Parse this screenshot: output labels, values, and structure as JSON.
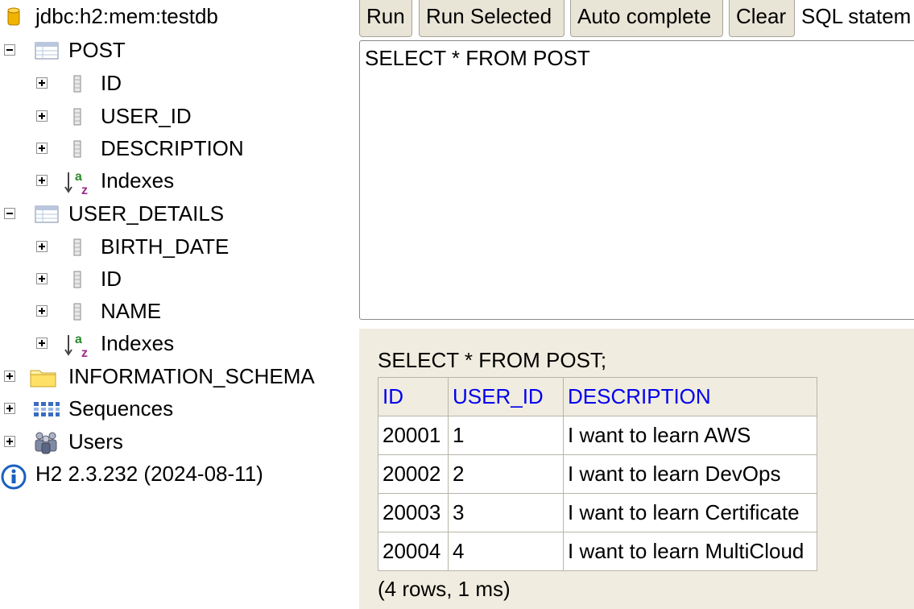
{
  "tree": {
    "connection": "jdbc:h2:mem:testdb",
    "tables": [
      {
        "name": "POST",
        "columns": [
          "ID",
          "USER_ID",
          "DESCRIPTION"
        ],
        "indexes_label": "Indexes"
      },
      {
        "name": "USER_DETAILS",
        "columns": [
          "BIRTH_DATE",
          "ID",
          "NAME"
        ],
        "indexes_label": "Indexes"
      }
    ],
    "information_schema": "INFORMATION_SCHEMA",
    "sequences": "Sequences",
    "users": "Users",
    "version": "H2 2.3.232 (2024-08-11)"
  },
  "toolbar": {
    "run": "Run",
    "run_selected": "Run Selected",
    "auto_complete": "Auto complete",
    "clear": "Clear",
    "sql_label": "SQL statem"
  },
  "editor": {
    "sql": "SELECT * FROM POST"
  },
  "result": {
    "statement": "SELECT * FROM POST;",
    "headers": [
      "ID",
      "USER_ID",
      "DESCRIPTION"
    ],
    "rows": [
      [
        "20001",
        "1",
        "I want to learn AWS"
      ],
      [
        "20002",
        "2",
        "I want to learn DevOps"
      ],
      [
        "20003",
        "3",
        "I want to learn Certificate"
      ],
      [
        "20004",
        "4",
        "I want to learn MultiCloud"
      ]
    ],
    "footer": "(4 rows, 1 ms)"
  },
  "colors": {
    "header_link": "#0000ee",
    "panel_bg": "#f0ecdf",
    "button_bg": "#e8e4d6"
  }
}
